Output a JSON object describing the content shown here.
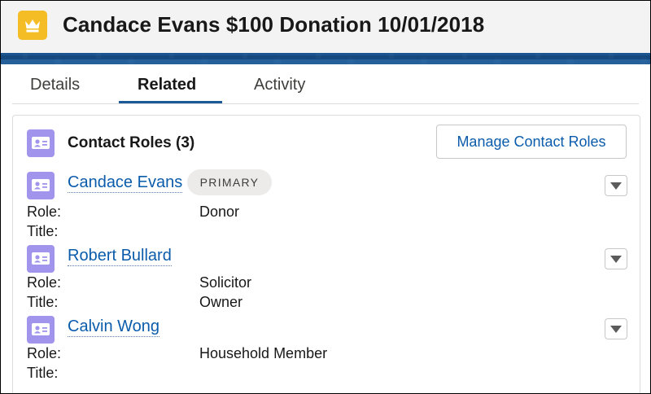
{
  "record": {
    "title": "Candace Evans $100 Donation 10/01/2018",
    "icon": "crown-icon",
    "icon_color": "#f4bc25"
  },
  "tabs": [
    {
      "label": "Details",
      "active": false
    },
    {
      "label": "Related",
      "active": true
    },
    {
      "label": "Activity",
      "active": false
    }
  ],
  "contact_roles": {
    "title": "Contact Roles (3)",
    "icon": "contact-card-icon",
    "icon_color": "#a094ed",
    "manage_label": "Manage Contact Roles",
    "role_label": "Role:",
    "title_label": "Title:",
    "items": [
      {
        "name": "Candace Evans",
        "badge": "PRIMARY",
        "role": "Donor",
        "title": ""
      },
      {
        "name": "Robert Bullard",
        "badge": "",
        "role": "Solicitor",
        "title": "Owner"
      },
      {
        "name": "Calvin Wong",
        "badge": "",
        "role": "Household Member",
        "title": ""
      }
    ]
  },
  "colors": {
    "link": "#0b5cab",
    "tab_underline": "#1b5a99",
    "banner": "#174b82"
  }
}
